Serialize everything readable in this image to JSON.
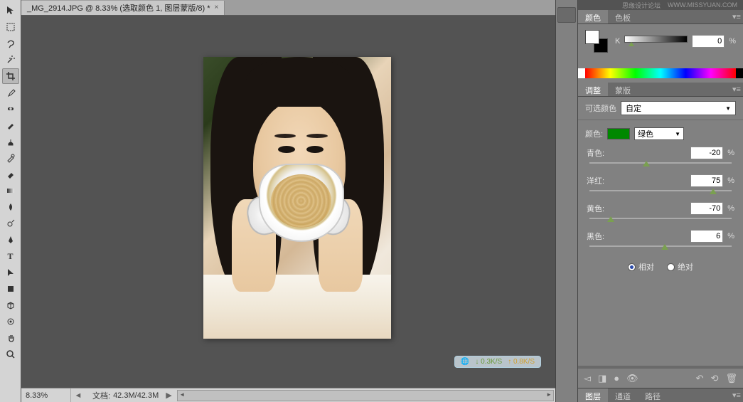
{
  "document": {
    "tab_title": "_MG_2914.JPG @ 8.33% (选取颜色 1, 图层蒙版/8) *",
    "zoom": "8.33%",
    "info_label": "文档:",
    "info_value": "42.3M/42.3M"
  },
  "net": {
    "down": "0.3K/S",
    "up": "0.8K/S"
  },
  "watermark": {
    "site": "思缘设计论坛",
    "url": "WWW.MISSYUAN.COM"
  },
  "panels": {
    "color_tabs": [
      "颜色",
      "色板"
    ],
    "color_active": 0,
    "k_label": "K",
    "k_value": "0",
    "pct": "%",
    "adjust_tabs": [
      "调整",
      "蒙版"
    ],
    "adjust_active": 0,
    "adj_type_label": "可选颜色",
    "adj_preset": "自定",
    "target_label": "颜色:",
    "target_value": "绿色",
    "sliders": [
      {
        "label": "青色:",
        "value": "-20",
        "pos": 40
      },
      {
        "label": "洋红:",
        "value": "75",
        "pos": 87
      },
      {
        "label": "黄色:",
        "value": "-70",
        "pos": 15
      },
      {
        "label": "黑色:",
        "value": "6",
        "pos": 53
      }
    ],
    "method": {
      "relative": "相对",
      "absolute": "绝对",
      "checked": "relative"
    },
    "layers_tabs": [
      "图层",
      "通道",
      "路径"
    ]
  }
}
